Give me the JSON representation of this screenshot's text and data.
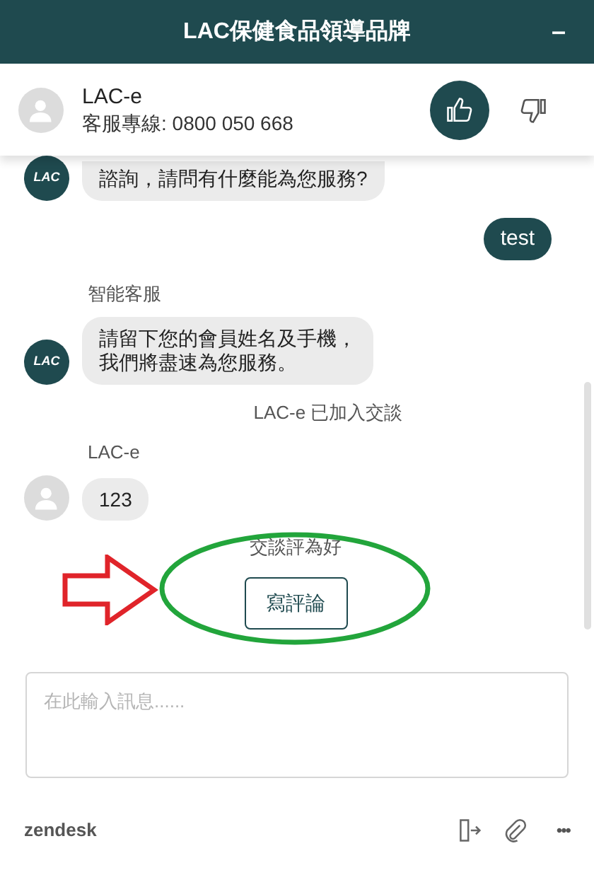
{
  "header": {
    "title": "LAC保健食品領導品牌",
    "minimize": "–"
  },
  "agent": {
    "name": "LAC-e",
    "hotline": "客服專線: 0800 050 668"
  },
  "rating_buttons": [
    {
      "kind": "up",
      "selected": true
    },
    {
      "kind": "down",
      "selected": false
    }
  ],
  "messages": [
    {
      "kind": "bot",
      "logo": "LAC",
      "lines": [
        "諮詢，請問有什麼能為您服務?"
      ]
    },
    {
      "kind": "user",
      "lines": [
        "test"
      ]
    },
    {
      "kind": "bot",
      "sender": "智能客服",
      "logo": "LAC",
      "lines": [
        "請留下您的會員姓名及手機，",
        "我們將盡速為您服務。"
      ]
    },
    {
      "kind": "system",
      "lines": [
        "LAC-e 已加入交談"
      ]
    },
    {
      "kind": "agent",
      "sender": "LAC-e",
      "lines": [
        "123"
      ]
    }
  ],
  "rating": {
    "text": "交談評為好",
    "button": "寫評論"
  },
  "input": {
    "placeholder": "在此輸入訊息......"
  },
  "footer": {
    "brand": "zendesk",
    "more": "•••"
  }
}
